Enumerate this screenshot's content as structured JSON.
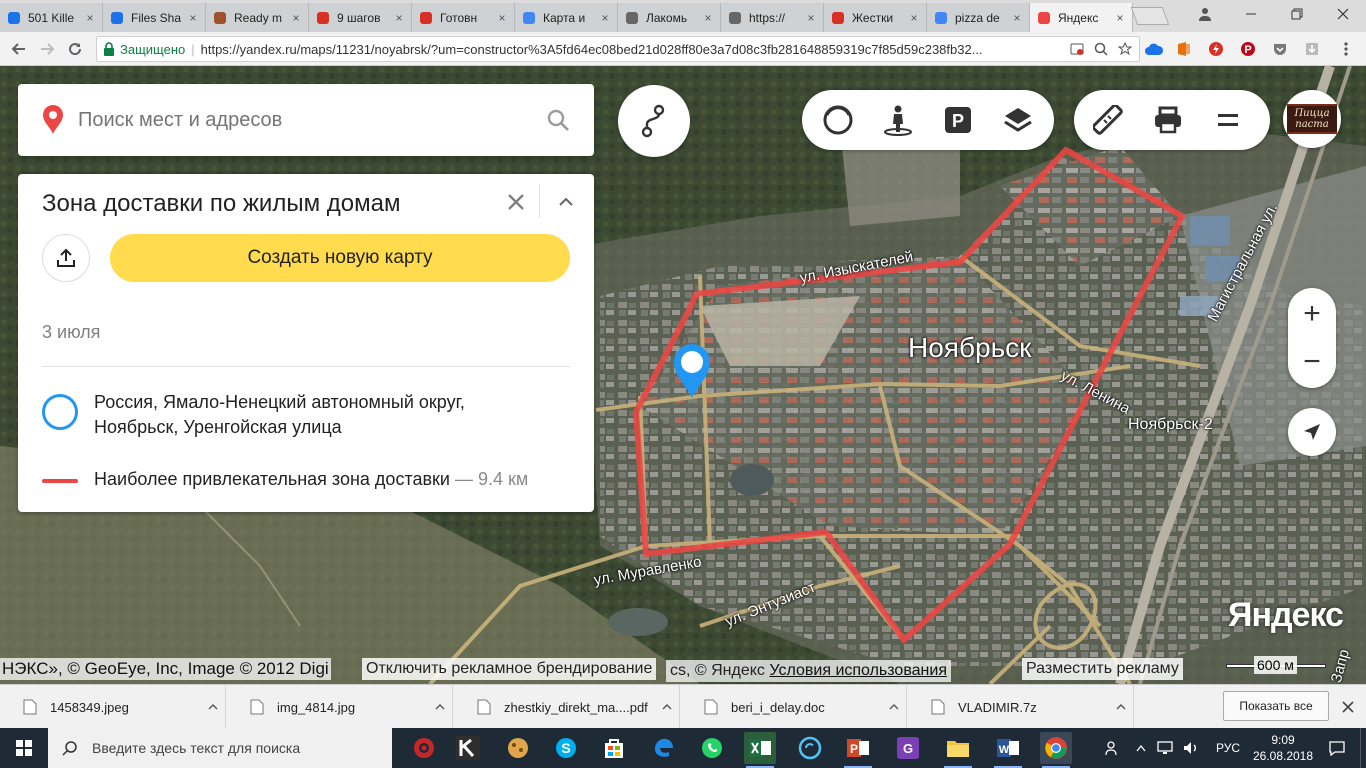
{
  "browser": {
    "tabs": [
      {
        "label": "501 Kille",
        "icon": "play-icon",
        "color": "#1a73e8"
      },
      {
        "label": "Files Sha",
        "icon": "files-icon",
        "color": "#1a73e8"
      },
      {
        "label": "Ready m",
        "icon": "cookie-icon",
        "color": "#a0522d"
      },
      {
        "label": "9 шагов",
        "icon": "ib-icon",
        "color": "#d93025"
      },
      {
        "label": "Готовн",
        "icon": "gmail-icon",
        "color": "#d93025"
      },
      {
        "label": "Карта и",
        "icon": "docs-icon",
        "color": "#4285f4"
      },
      {
        "label": "Лакомь",
        "icon": "page-icon",
        "color": "#666666"
      },
      {
        "label": "https://",
        "icon": "page-icon",
        "color": "#666666"
      },
      {
        "label": "Жестки",
        "icon": "k-icon",
        "color": "#d93025"
      },
      {
        "label": "pizza de",
        "icon": "google-icon",
        "color": "#4285f4"
      },
      {
        "label": "Яндекс",
        "icon": "map-pin-icon",
        "color": "#ed4543"
      }
    ],
    "secure_label": "Защищено",
    "url": "https://yandex.ru/maps/11231/noyabrsk/?um=constructor%3A5fd64ec08bed21d028ff80e3a7d08c3fb281648859319c7f85d59c238fb32..."
  },
  "map": {
    "search_placeholder": "Поиск мест и адресов",
    "panel": {
      "title": "Зона доставки по жилым домам",
      "create_button": "Создать новую карту",
      "date": "3 июля",
      "address_line1": "Россия, Ямало-Ненецкий автономный округ,",
      "address_line2": "Ноябрьск, Уренгойская улица",
      "zone_label": "Наиболее привлекательная зона доставки",
      "zone_length": "— 9.4 км",
      "circle_color": "#2196f3",
      "zone_color": "#ed4543"
    },
    "labels": {
      "city": "Ноябрьск",
      "station": "Ноябрьск-2",
      "street_izyskateley": "ул. Изыскателей",
      "street_lenina": "ул. Ленина",
      "street_muravlenko": "ул. Муравленко",
      "street_entuziastov": "ул. Энтузиаст",
      "street_magistralnaya": "Магистральная ул.",
      "street_zapr": "Запр"
    },
    "brand": {
      "line1": "Пицца",
      "line2": "паста"
    },
    "watermark": "Яндекс",
    "copyright_prefix": "НЭКС», © GeoEye, Inc, Image © 2012 Digi",
    "copyright_mid": "cs, © Яндекс ",
    "terms_link": "Условия использования",
    "disable_branding": "Отключить рекламное брендирование",
    "place_ad": "Разместить рекламу",
    "scale": "600 м",
    "zoom_in": "+",
    "zoom_out": "−"
  },
  "downloads": {
    "items": [
      {
        "name": "1458349.jpeg",
        "icon": "image-file-icon"
      },
      {
        "name": "img_4814.jpg",
        "icon": "image-file-icon"
      },
      {
        "name": "zhestkiy_direkt_ma....pdf",
        "icon": "pdf-file-icon"
      },
      {
        "name": "beri_i_delay.doc",
        "icon": "doc-file-icon"
      },
      {
        "name": "VLADIMIR.7z",
        "icon": "archive-file-icon"
      }
    ],
    "show_all": "Показать все"
  },
  "taskbar": {
    "search_placeholder": "Введите здесь текст для поиска",
    "language": "РУС",
    "time": "9:09",
    "date": "26.08.2018"
  }
}
